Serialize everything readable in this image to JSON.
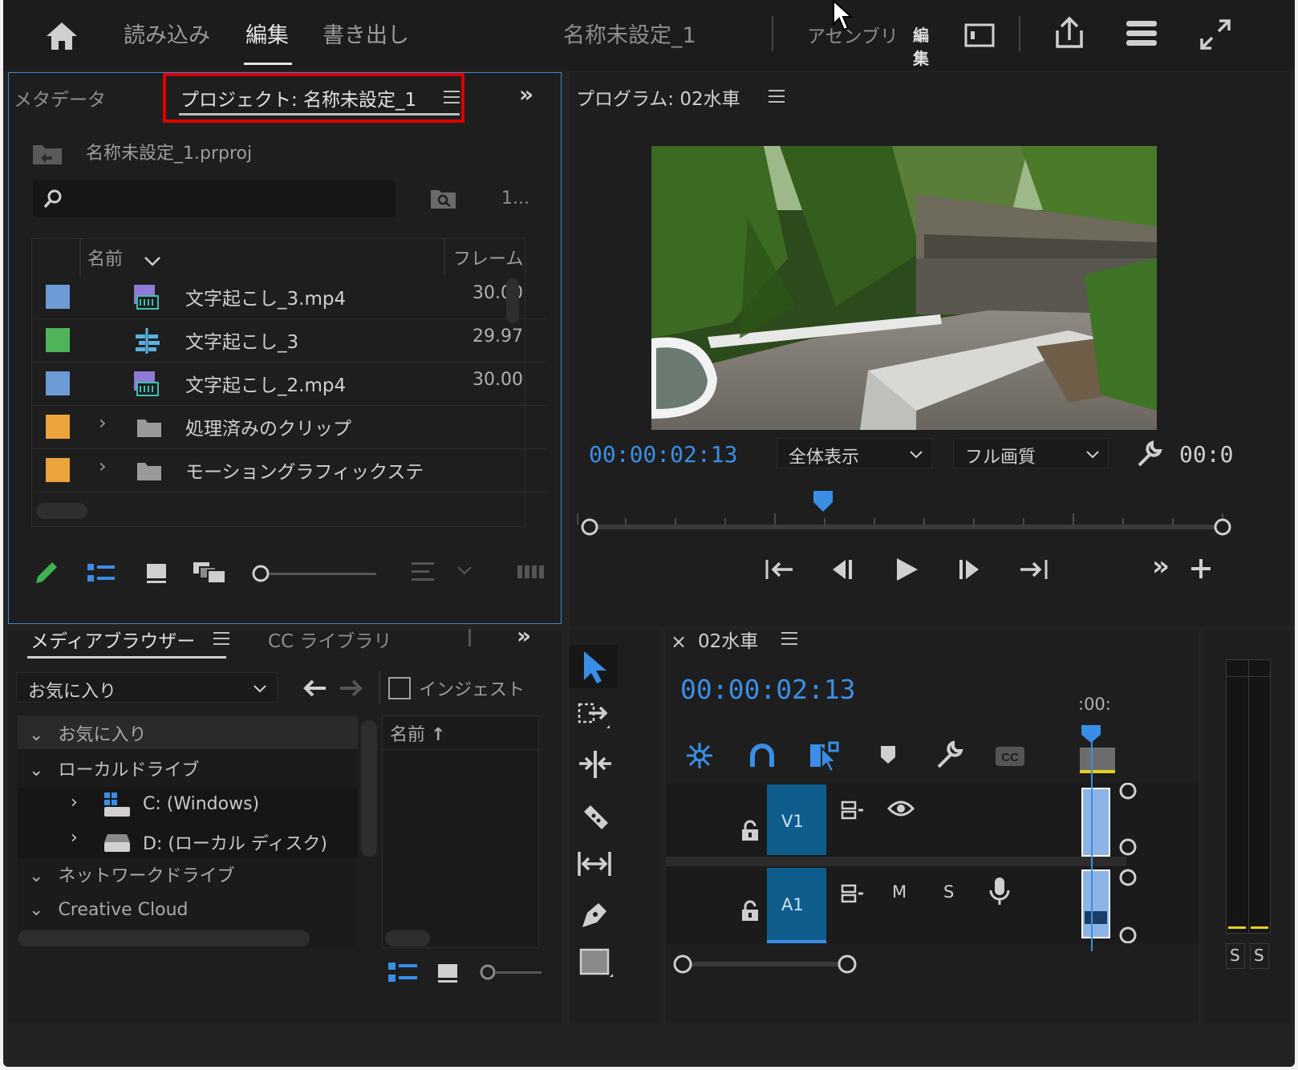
{
  "topbar": {
    "tabs": [
      "読み込み",
      "編集",
      "書き出し"
    ],
    "active_tab": "編集",
    "project_title": "名称未設定_1",
    "workspaces": [
      "アセンブリ",
      "編集"
    ]
  },
  "project_panel": {
    "tab_metadata": "メタデータ",
    "tab_project": "プロジェクト: 名称未設定_1",
    "file": "名称未設定_1.prproj",
    "search_placeholder": "",
    "item_count": "1...",
    "col_name": "名前",
    "col_frame": "フレーム",
    "rows": [
      {
        "name": "文字起こし_3.mp4",
        "frame": "30.00",
        "color": "#6c9bd6",
        "icon": "video-clip-icon"
      },
      {
        "name": "文字起こし_3",
        "frame": "29.97",
        "color": "#4fb35a",
        "icon": "sequence-icon"
      },
      {
        "name": "文字起こし_2.mp4",
        "frame": "30.00",
        "color": "#6c9bd6",
        "icon": "video-clip-icon"
      },
      {
        "name": "処理済みのクリップ",
        "frame": "",
        "color": "#eba43c",
        "icon": "folder-icon"
      },
      {
        "name": "モーショングラフィックステ",
        "frame": "",
        "color": "#eba43c",
        "icon": "folder-icon"
      }
    ]
  },
  "program_panel": {
    "title": "プログラム: 02水車",
    "timecode": "00:00:02:13",
    "zoom": "全体表示",
    "quality": "フル画質",
    "duration": "00:0",
    "playhead_fraction": 0.38
  },
  "media_panel": {
    "tab_media": "メディアブラウザー",
    "tab_cc": "CC ライブラリ",
    "favorites": "お気に入り",
    "ingest": "インジェスト",
    "col_name": "名前",
    "tree": [
      {
        "label": "お気に入り",
        "level": 0
      },
      {
        "label": "ローカルドライブ",
        "level": 0
      },
      {
        "label": "C: (Windows)",
        "level": 1
      },
      {
        "label": "D: (ローカル ディスク)",
        "level": 1
      },
      {
        "label": "ネットワークドライブ",
        "level": 0
      },
      {
        "label": "Creative Cloud",
        "level": 0
      }
    ]
  },
  "timeline": {
    "title": "02水車",
    "timecode": "00:00:02:13",
    "ruler": ":00:",
    "tracks": [
      {
        "name": "V1",
        "buttons": [
          "eye"
        ]
      },
      {
        "name": "A1",
        "buttons": [
          "M",
          "S"
        ]
      }
    ]
  },
  "meter": {
    "s1": "S",
    "s2": "S"
  },
  "colors": {
    "accent": "#3a8ee6",
    "track": "#0f5d8c",
    "highlight": "#e00000"
  }
}
